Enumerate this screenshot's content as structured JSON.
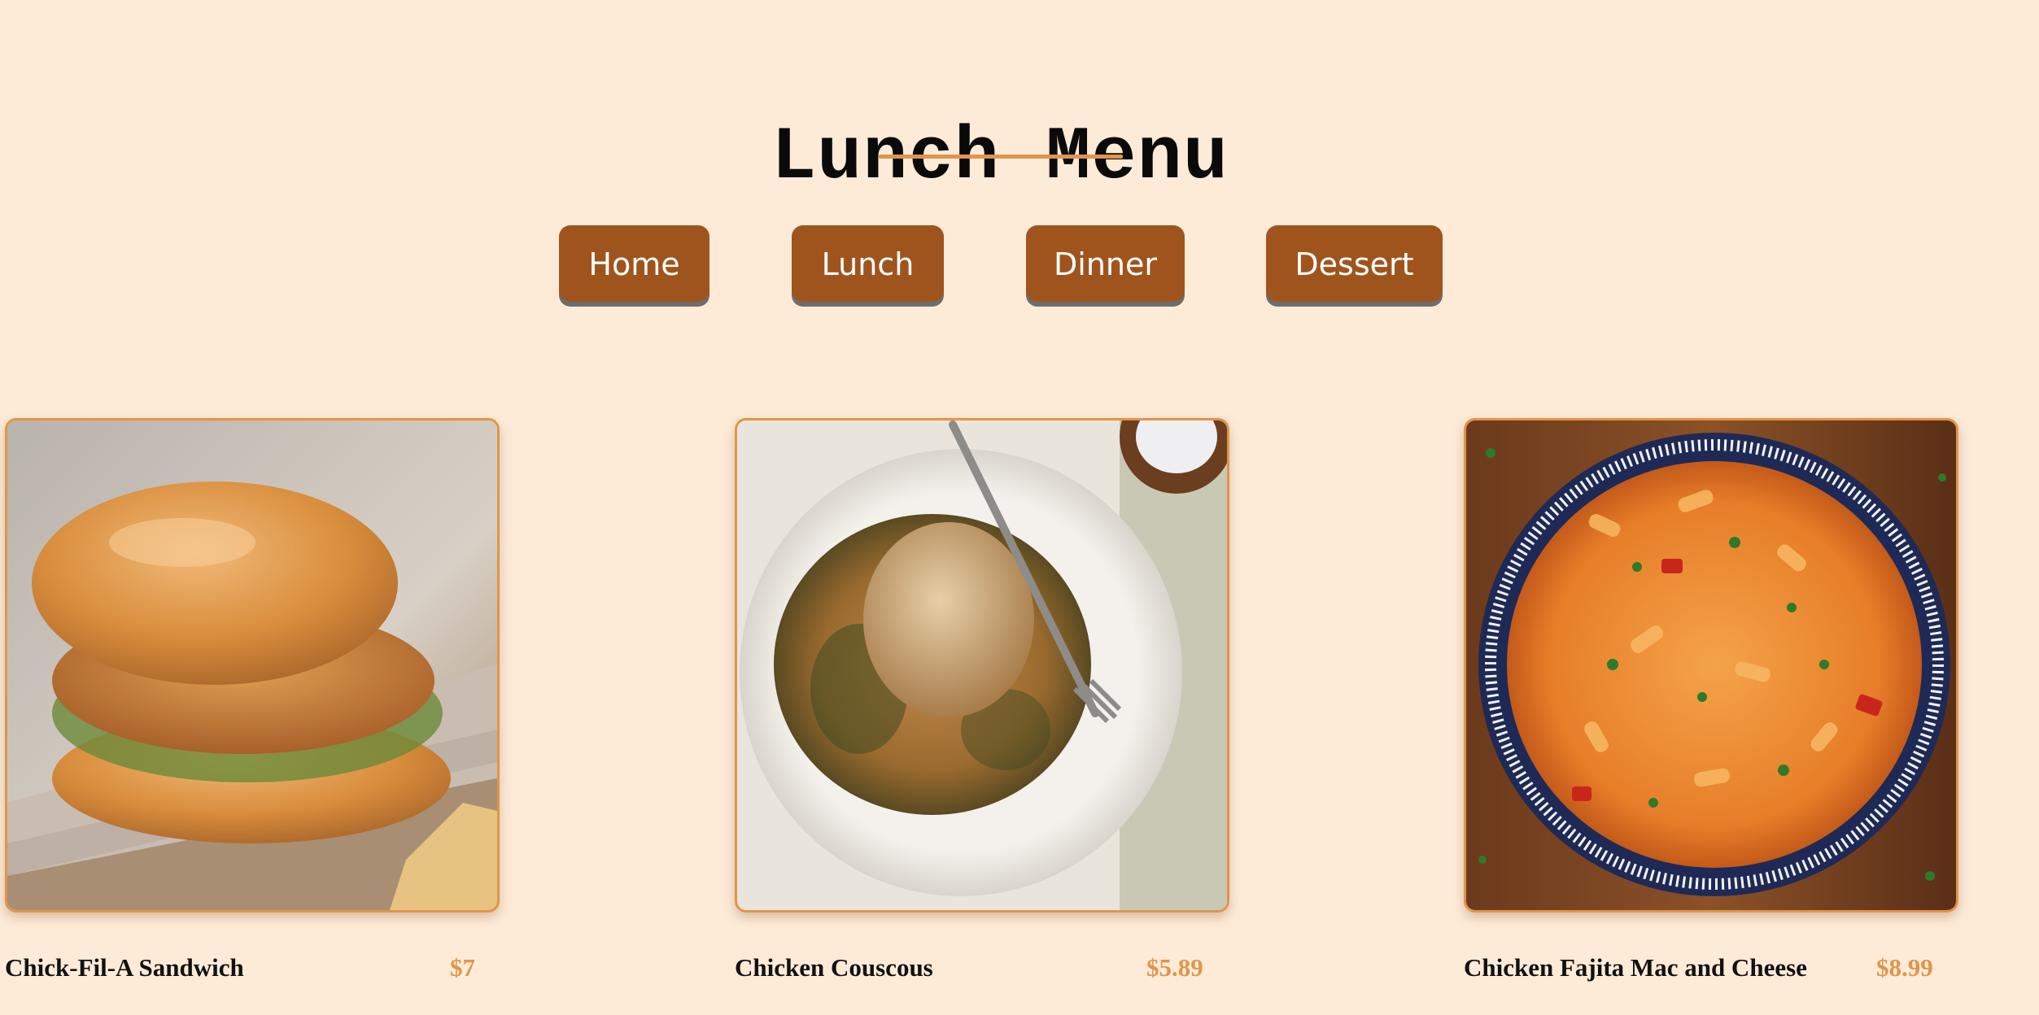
{
  "header": {
    "title": "Lunch Menu"
  },
  "nav": {
    "items": [
      {
        "label": "Home"
      },
      {
        "label": "Lunch"
      },
      {
        "label": "Dinner"
      },
      {
        "label": "Dessert"
      }
    ]
  },
  "menu": {
    "items": [
      {
        "name": "Chick-Fil-A Sandwich",
        "price": "$7",
        "image": "chicken-sandwich-photo"
      },
      {
        "name": "Chicken Couscous",
        "price": "$5.89",
        "image": "chicken-couscous-photo"
      },
      {
        "name": "Chicken Fajita Mac and Cheese",
        "price": "$8.99",
        "image": "fajita-mac-and-cheese-photo"
      }
    ]
  },
  "colors": {
    "background": "#fdebd8",
    "button": "#a0541d",
    "accent": "#e0954a",
    "title": "#0a0a0a"
  }
}
